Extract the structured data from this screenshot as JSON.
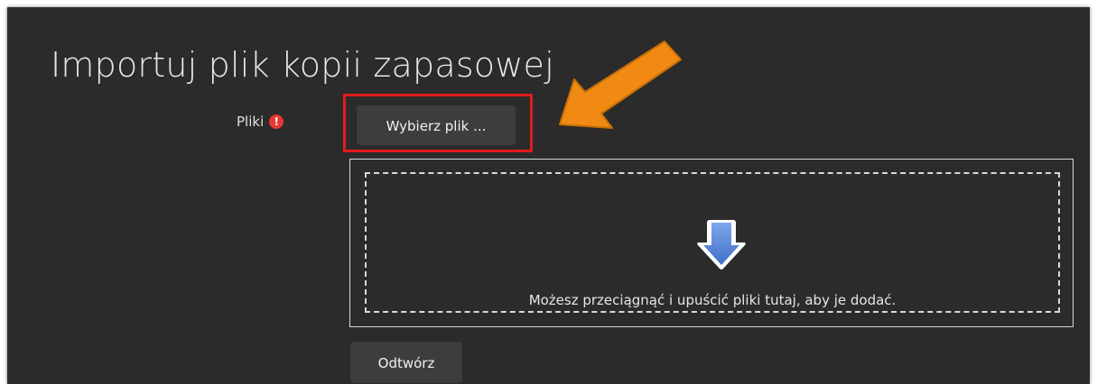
{
  "page": {
    "title": "Importuj plik kopii zapasowej"
  },
  "files_field": {
    "label": "Pliki",
    "required_icon": "exclamation-circle-icon",
    "required_glyph": "!",
    "required_color": "#e53935",
    "choose_button_label": "Wybierz plik ..."
  },
  "dropzone": {
    "icon": "download-arrow-icon",
    "text": "Możesz przeciągnąć i upuścić pliki tutaj, aby je dodać."
  },
  "actions": {
    "restore_label": "Odtwórz"
  },
  "annotations": {
    "highlight_color": "#e11b1b",
    "arrow_color": "#f08a12"
  }
}
